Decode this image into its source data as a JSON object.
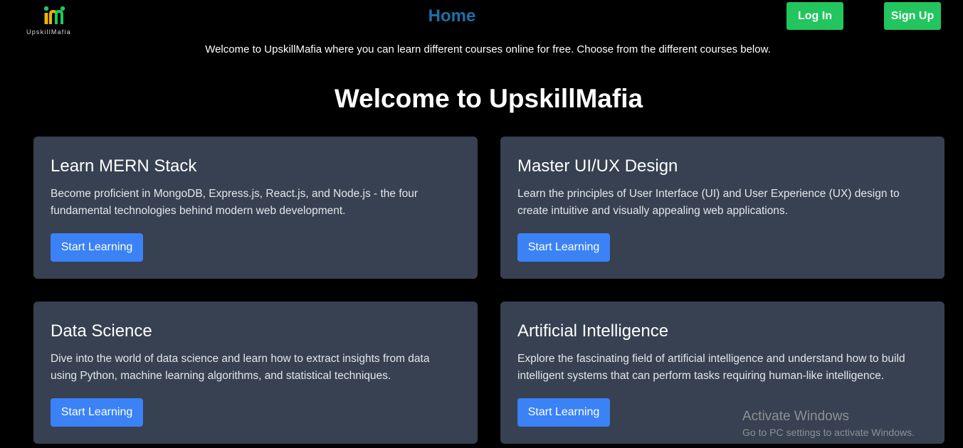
{
  "brand": {
    "name": "UpskillMafia"
  },
  "nav": {
    "home_label": "Home",
    "login_label": "Log In",
    "signup_label": "Sign Up"
  },
  "intro_text": "Welcome to UpskillMafia where you can learn different courses online for free. Choose from the different courses below.",
  "main_heading": "Welcome to UpskillMafia",
  "courses": [
    {
      "title": "Learn MERN Stack",
      "description": "Become proficient in MongoDB, Express.js, React.js, and Node.js - the four fundamental technologies behind modern web development.",
      "button_label": "Start Learning"
    },
    {
      "title": "Master UI/UX Design",
      "description": "Learn the principles of User Interface (UI) and User Experience (UX) design to create intuitive and visually appealing web applications.",
      "button_label": "Start Learning"
    },
    {
      "title": "Data Science",
      "description": "Dive into the world of data science and learn how to extract insights from data using Python, machine learning algorithms, and statistical techniques.",
      "button_label": "Start Learning"
    },
    {
      "title": "Artificial Intelligence",
      "description": "Explore the fascinating field of artificial intelligence and understand how to build intelligent systems that can perform tasks requiring human-like intelligence.",
      "button_label": "Start Learning"
    }
  ],
  "watermark": {
    "title": "Activate Windows",
    "subtitle": "Go to PC settings to activate Windows."
  },
  "colors": {
    "background": "#000000",
    "card": "#374151",
    "primary_button": "#3b82f6",
    "auth_button": "#22c55e",
    "home_link": "#1f6fa8"
  },
  "icons": {
    "logo": "upskillmafia-logo-icon"
  }
}
